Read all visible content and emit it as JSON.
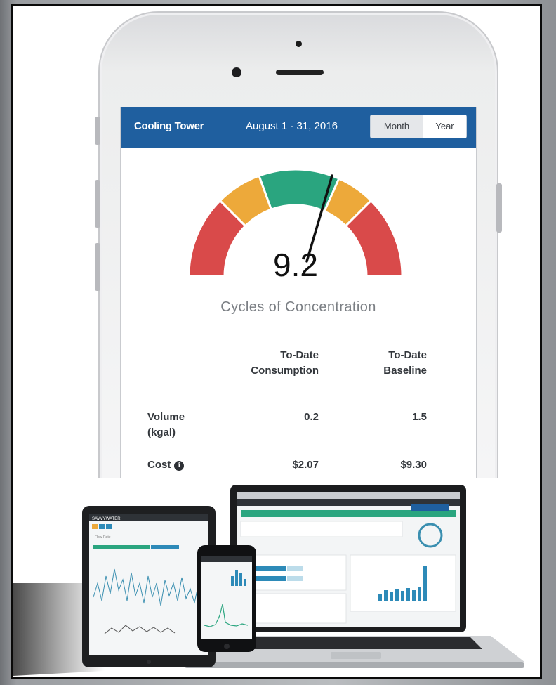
{
  "header": {
    "title": "Cooling Tower",
    "date_range": "August 1 - 31, 2016",
    "toggle": {
      "month": "Month",
      "year": "Year",
      "selected": "Month"
    }
  },
  "gauge": {
    "value": "9.2",
    "label": "Cycles of Concentration",
    "colors": {
      "red": "#d94a4a",
      "orange": "#eda93a",
      "green": "#2aa57f"
    }
  },
  "table": {
    "columns": [
      "",
      "To-Date Consumption",
      "To-Date Baseline"
    ],
    "col1_line1": "To-Date",
    "col1_line2": "Consumption",
    "col2_line1": "To-Date",
    "col2_line2": "Baseline",
    "rows": [
      {
        "label_line1": "Volume",
        "label_line2": "(kgal)",
        "consumption": "0.2",
        "baseline": "1.5"
      },
      {
        "label_line1": "Cost",
        "label_line2": "",
        "consumption": "$2.07",
        "baseline": "$9.30"
      }
    ]
  },
  "devices": {
    "tablet_brand": "SAVVYWATER",
    "tablet_sub": "Flow Rate"
  }
}
